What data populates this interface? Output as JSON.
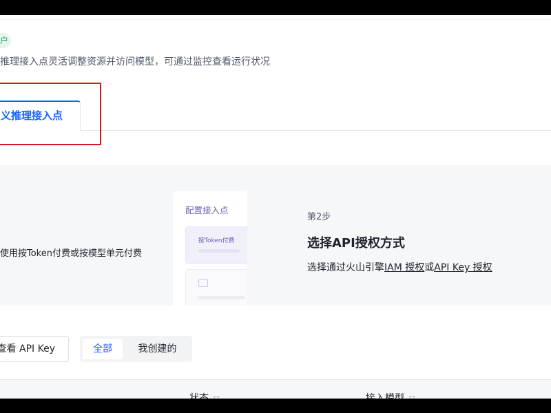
{
  "badge": "户",
  "description": "推理接入点灵活调整资源并访问模型，可通过监控查看运行状况",
  "tab": {
    "label": "义推理接入点"
  },
  "guide": {
    "left_text": "使用按Token付费或按模型单元付费",
    "preview": {
      "title": "配置接入点",
      "card_text": "按Token付费"
    },
    "step": {
      "label": "第2步",
      "title": "选择API授权方式",
      "desc_prefix": "选择通过火山引擎",
      "link_iam": "IAM 授权",
      "desc_or": "或",
      "link_apikey": "API Key 授权"
    }
  },
  "toolbar": {
    "view_api_key": "查看 API Key",
    "filter_all": "全部",
    "filter_mine": "我创建的"
  },
  "table": {
    "columns": [
      {
        "label": "状态"
      },
      {
        "label": "接入模型"
      }
    ]
  },
  "colors": {
    "accent": "#1664ff",
    "highlight_box": "#e1131c"
  },
  "icons": {
    "filter": "filter-icon"
  }
}
